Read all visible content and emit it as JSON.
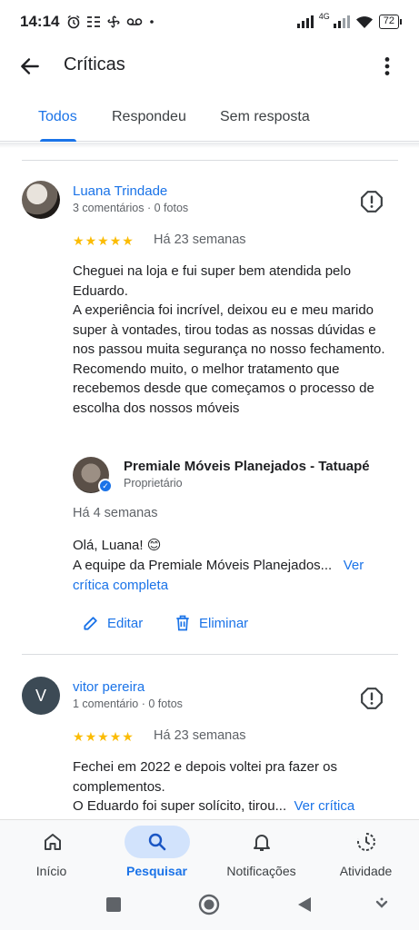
{
  "status_bar": {
    "time": "14:14",
    "network_type": "4G",
    "battery": "72",
    "notification_icons": [
      "alarm-icon",
      "tasks-icon",
      "fan-icon",
      "voicemail-icon",
      "dot-icon"
    ]
  },
  "app_bar": {
    "title": "Críticas",
    "back_icon": "arrow-left-icon",
    "more_icon": "more-vert-icon"
  },
  "tabs": [
    {
      "label": "Todos",
      "active": true
    },
    {
      "label": "Respondeu",
      "active": false
    },
    {
      "label": "Sem resposta",
      "active": false
    }
  ],
  "reviews": [
    {
      "name": "Luana Trindade",
      "meta": "3 comentários · 0 fotos",
      "rating": 5,
      "time": "Há 23 semanas",
      "text": "Cheguei na loja e fui super bem atendida pelo Eduardo.\nA experiência foi incrível, deixou eu e meu marido super à vontades, tirou todas as nossas dúvidas e nos passou muita segurança no nosso fechamento.\nRecomendo muito, o melhor tratamento que recebemos desde que começamos o processo de escolha dos nossos móveis",
      "reply": {
        "owner_name": "Premiale Móveis Planejados - Tatuapé",
        "owner_role": "Proprietário",
        "time": "Há 4 semanas",
        "greeting": "Olá, Luana! 😊",
        "text": "A equipe da Premiale Móveis Planejados...",
        "more_link": "Ver crítica completa"
      },
      "actions": {
        "edit": "Editar",
        "delete": "Eliminar"
      }
    },
    {
      "name": "vitor pereira",
      "avatar_letter": "V",
      "meta": "1 comentário · 0 fotos",
      "rating": 5,
      "time": "Há 23 semanas",
      "text": "Fechei em 2022 e depois voltei pra fazer os complementos.\nO Eduardo foi super solícito, tirou...",
      "more_link": "Ver crítica"
    }
  ],
  "bottom_nav": [
    {
      "label": "Início",
      "icon": "home-icon",
      "active": false
    },
    {
      "label": "Pesquisar",
      "icon": "search-icon",
      "active": true
    },
    {
      "label": "Notificações",
      "icon": "bell-icon",
      "active": false
    },
    {
      "label": "Atividade",
      "icon": "activity-icon",
      "active": false
    }
  ],
  "colors": {
    "accent": "#1a73e8",
    "star": "#fbbc04",
    "active_pill": "#d2e3fc"
  }
}
